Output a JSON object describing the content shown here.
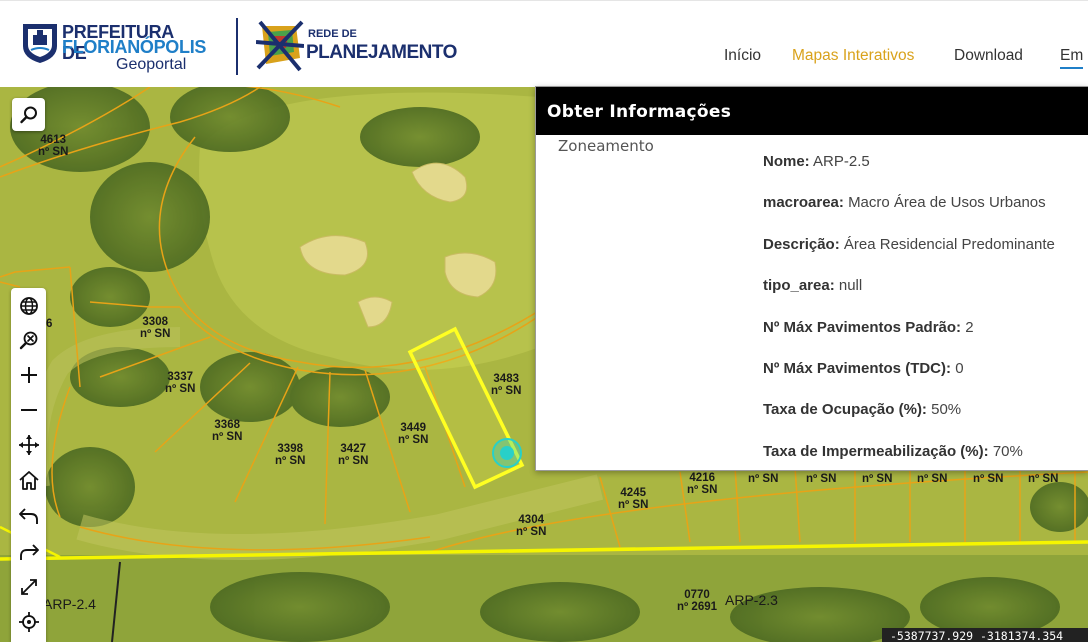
{
  "header": {
    "logo_line1": "PREFEITURA DE",
    "logo_line2": "FLORIANÓPOLIS",
    "logo_sub": "Geoportal",
    "rede_small": "REDE DE",
    "rede_big": "PLANEJAMENTO",
    "nav": [
      {
        "label": "Início",
        "active": false
      },
      {
        "label": "Mapas Interativos",
        "active": true
      },
      {
        "label": "Download",
        "active": false
      },
      {
        "label": "Em",
        "active": false
      }
    ],
    "colors": {
      "navy": "#1b2f6e",
      "blue": "#1f7fc8",
      "accent": "#d9a21c"
    }
  },
  "map": {
    "parcels": [
      {
        "number": "4613",
        "street_no": "nº SN"
      },
      {
        "number": "3308",
        "street_no": "nº SN"
      },
      {
        "number": "3337",
        "street_no": "nº SN"
      },
      {
        "number": "3368",
        "street_no": "nº SN"
      },
      {
        "number": "3398",
        "street_no": "nº SN"
      },
      {
        "number": "3427",
        "street_no": "nº SN"
      },
      {
        "number": "3449",
        "street_no": "nº SN"
      },
      {
        "number": "3483",
        "street_no": "nº SN"
      },
      {
        "number": "4216",
        "street_no": "nº SN"
      },
      {
        "number": "4245",
        "street_no": "nº SN"
      },
      {
        "number": "4304",
        "street_no": "nº SN"
      },
      {
        "number": "0770",
        "street_no": "nº 2691"
      }
    ],
    "partial_label": "6",
    "row_labels": [
      "nº SN",
      "nº SN",
      "nº SN",
      "nº SN",
      "nº SN",
      "nº SN"
    ],
    "zones": [
      "ARP-2.4",
      "ARP-2.3"
    ],
    "coordinates": "-5387737.929 -3181374.354",
    "colors": {
      "parcel_line": "#e8a317",
      "zone_line": "#f5f500",
      "selection": "#ffff22",
      "marker": "#28d0c8"
    }
  },
  "controls": {
    "search": "search-icon",
    "tools": [
      "globe-icon",
      "zoom-search-icon",
      "zoom-in-icon",
      "zoom-out-icon",
      "pan-icon",
      "home-icon",
      "undo-icon",
      "redo-icon",
      "expand-icon",
      "locate-icon"
    ]
  },
  "panel": {
    "title": "Obter Informações",
    "layer": "Zoneamento",
    "attributes": [
      {
        "key": "Nome:",
        "value": "ARP-2.5"
      },
      {
        "key": "macroarea:",
        "value": "Macro Área de Usos Urbanos"
      },
      {
        "key": "Descrição:",
        "value": "Área Residencial Predominante"
      },
      {
        "key": "tipo_area:",
        "value": "null"
      },
      {
        "key": "Nº Máx Pavimentos Padrão:",
        "value": "2"
      },
      {
        "key": "Nº Máx Pavimentos (TDC):",
        "value": "0"
      },
      {
        "key": "Taxa de Ocupação (%):",
        "value": "50%"
      },
      {
        "key": "Taxa de Impermeabilização (%):",
        "value": "70%"
      }
    ]
  }
}
